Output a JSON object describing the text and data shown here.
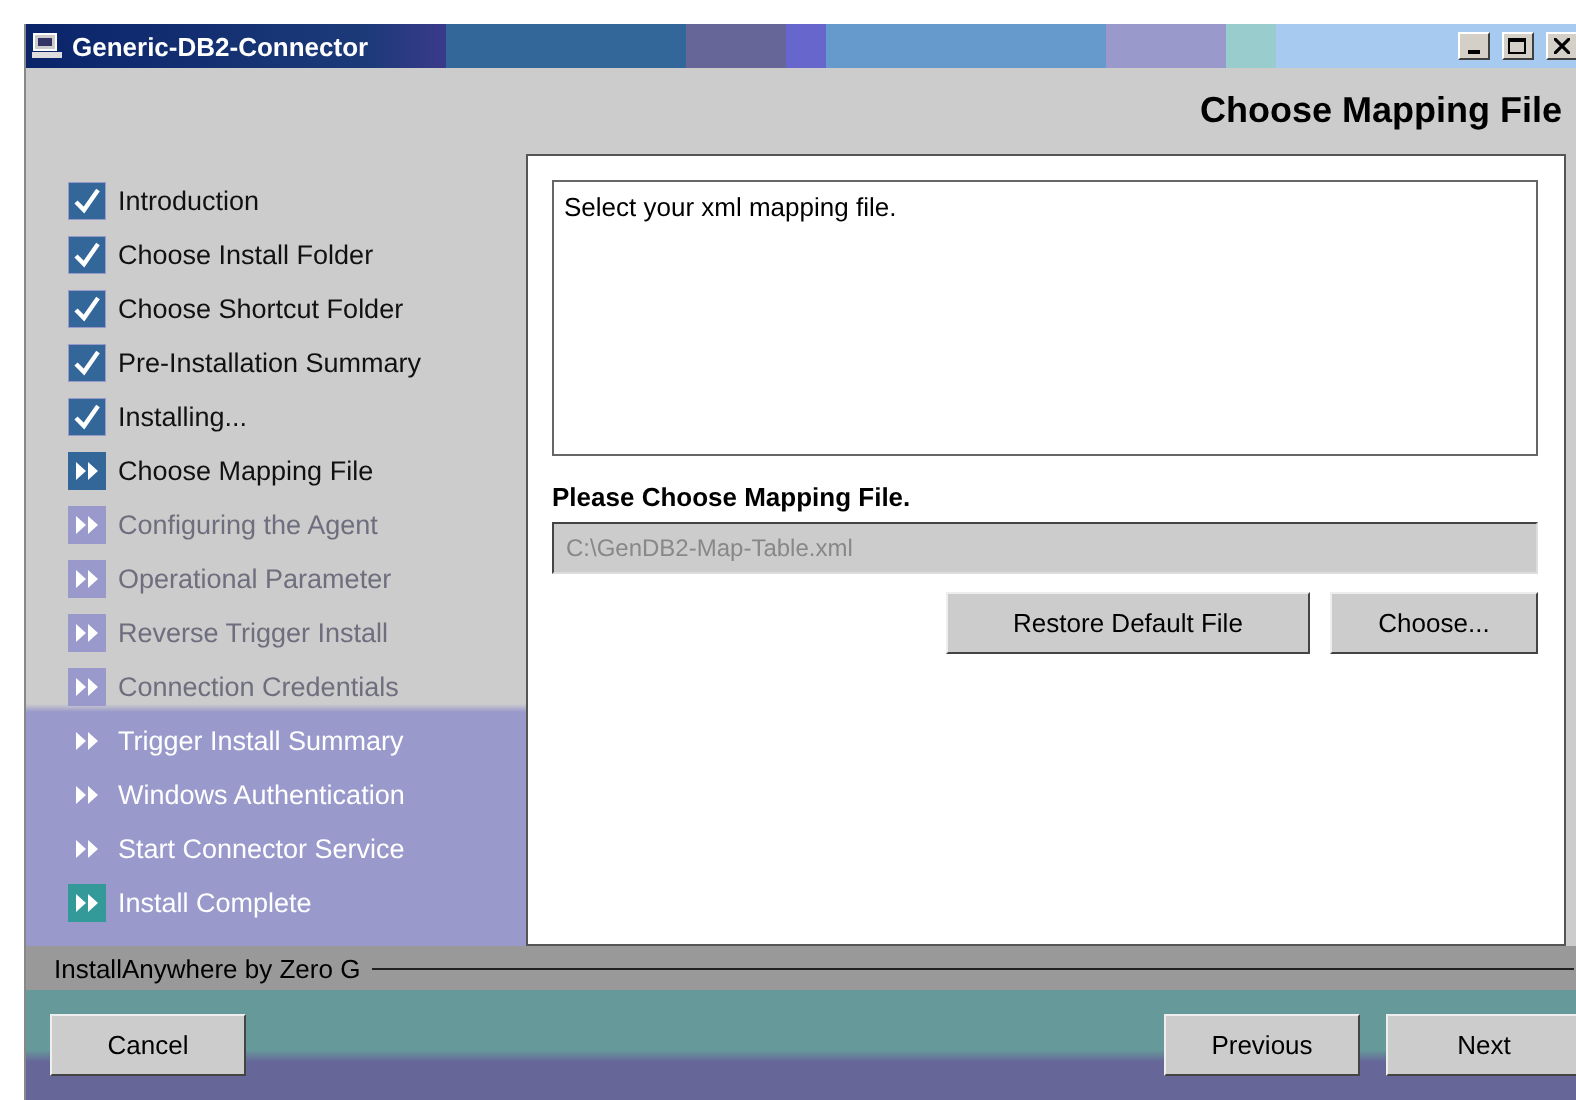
{
  "window": {
    "title": "Generic-DB2-Connector"
  },
  "header": "Choose Mapping File",
  "steps": [
    {
      "label": "Introduction",
      "completed": true,
      "active": false
    },
    {
      "label": "Choose Install Folder",
      "completed": true,
      "active": false
    },
    {
      "label": "Choose Shortcut Folder",
      "completed": true,
      "active": false
    },
    {
      "label": "Pre-Installation Summary",
      "completed": true,
      "active": false
    },
    {
      "label": "Installing...",
      "completed": true,
      "active": false
    },
    {
      "label": "Choose Mapping File",
      "completed": false,
      "active": true
    },
    {
      "label": "Configuring the Agent",
      "completed": false,
      "active": false
    },
    {
      "label": "Operational Parameter",
      "completed": false,
      "active": false
    },
    {
      "label": "Reverse Trigger Install",
      "completed": false,
      "active": false
    },
    {
      "label": "Connection Credentials",
      "completed": false,
      "active": false
    },
    {
      "label": "Trigger Install Summary",
      "completed": false,
      "active": false
    },
    {
      "label": "Windows Authentication",
      "completed": false,
      "active": false
    },
    {
      "label": "Start Connector Service",
      "completed": false,
      "active": false
    },
    {
      "label": "Install Complete",
      "completed": false,
      "active": false
    }
  ],
  "panel": {
    "message": "Select your xml mapping file.",
    "field_label": "Please Choose Mapping File.",
    "field": {
      "value": "C:\\GenDB2-Map-Table.xml",
      "disabled": true
    },
    "buttons": [
      "Restore Default File",
      "Choose..."
    ]
  },
  "footer": {
    "brand": "InstallAnywhere by Zero G",
    "buttons": {
      "cancel": "Cancel",
      "previous": "Previous",
      "next": "Next"
    }
  }
}
